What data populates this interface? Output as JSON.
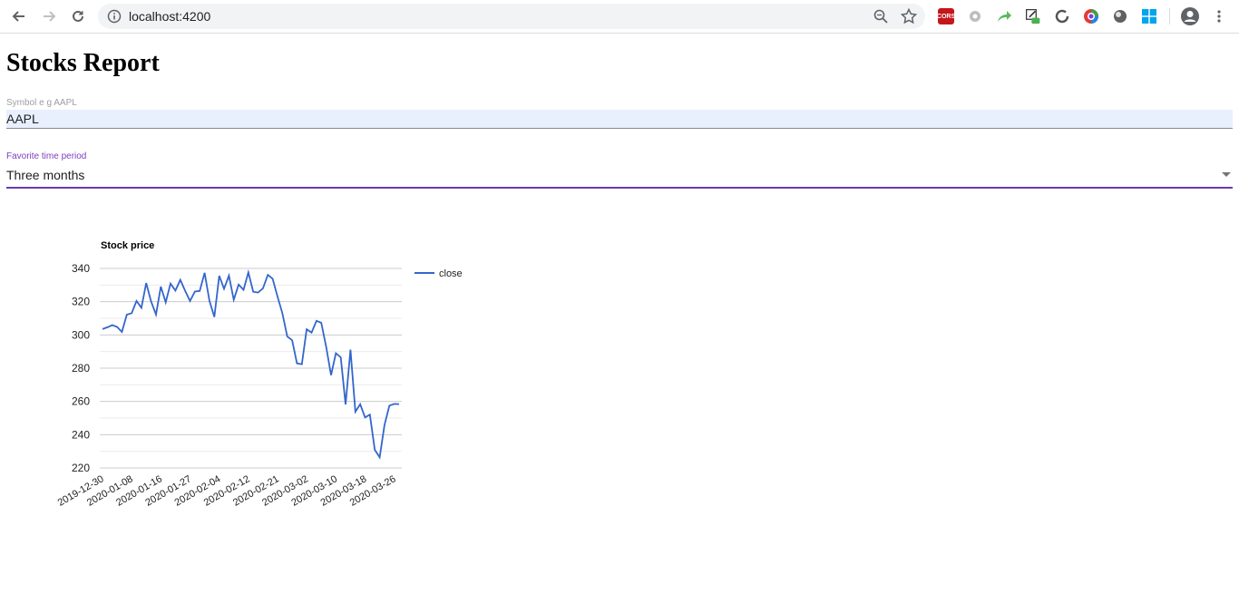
{
  "browser": {
    "url": "localhost:4200",
    "extensions": [
      {
        "name": "cors-extension-icon",
        "label": "CORS",
        "color": "#c4161c"
      },
      {
        "name": "grey-extension-icon",
        "label": "",
        "color": "#bdbdbd"
      },
      {
        "name": "share-arrow-extension-icon",
        "label": "",
        "color": "#5cb85c"
      },
      {
        "name": "edit-extension-icon",
        "label": "",
        "color": "#333333"
      },
      {
        "name": "refresh-extension-icon",
        "label": "",
        "color": "#555555"
      },
      {
        "name": "color-picker-extension-icon",
        "label": "",
        "color": "#7b3fe4"
      },
      {
        "name": "dark-circle-extension-icon",
        "label": "",
        "color": "#616161"
      },
      {
        "name": "windows-extension-icon",
        "label": "",
        "color": "#00a4ef"
      }
    ]
  },
  "page": {
    "title": "Stocks Report"
  },
  "symbol_field": {
    "label": "Symbol e g AAPL",
    "value": "AAPL"
  },
  "period_field": {
    "label": "Favorite time period",
    "selected": "Three months"
  },
  "colors": {
    "accent": "#673ab7",
    "series": "#3366cc",
    "grid": "#cccccc"
  },
  "chart_data": {
    "type": "line",
    "title": "Stock price",
    "xlabel": "",
    "ylabel": "",
    "ylim": [
      220,
      340
    ],
    "yticks": [
      220,
      240,
      260,
      280,
      300,
      320,
      340
    ],
    "xtick_labels": [
      "2019-12-30",
      "2020-01-08",
      "2020-01-16",
      "2020-01-27",
      "2020-02-04",
      "2020-02-12",
      "2020-02-21",
      "2020-03-02",
      "2020-03-10",
      "2020-03-18",
      "2020-03-26"
    ],
    "grid": true,
    "legend": "right",
    "series": [
      {
        "name": "close",
        "values": [
          303.5,
          304.6,
          305.9,
          304.8,
          301.8,
          312.2,
          313.1,
          320.4,
          316.3,
          331.2,
          320.1,
          312.3,
          329.1,
          319.6,
          330.9,
          326.7,
          333.1,
          326.6,
          320.4,
          326.1,
          326.5,
          337.4,
          320.6,
          310.8,
          335.6,
          327.8,
          335.7,
          321.2,
          330.3,
          327.1,
          337.6,
          326.0,
          325.5,
          328.0,
          336.1,
          333.8,
          323.0,
          313.1,
          299.1,
          296.8,
          282.9,
          282.4,
          303.4,
          301.4,
          308.5,
          307.3,
          292.9,
          275.8,
          289.0,
          286.5,
          258.2,
          291.1,
          253.8,
          258.3,
          250.4,
          252.1,
          230.9,
          226.4,
          245.8,
          257.5,
          258.5,
          258.4
        ]
      }
    ]
  }
}
